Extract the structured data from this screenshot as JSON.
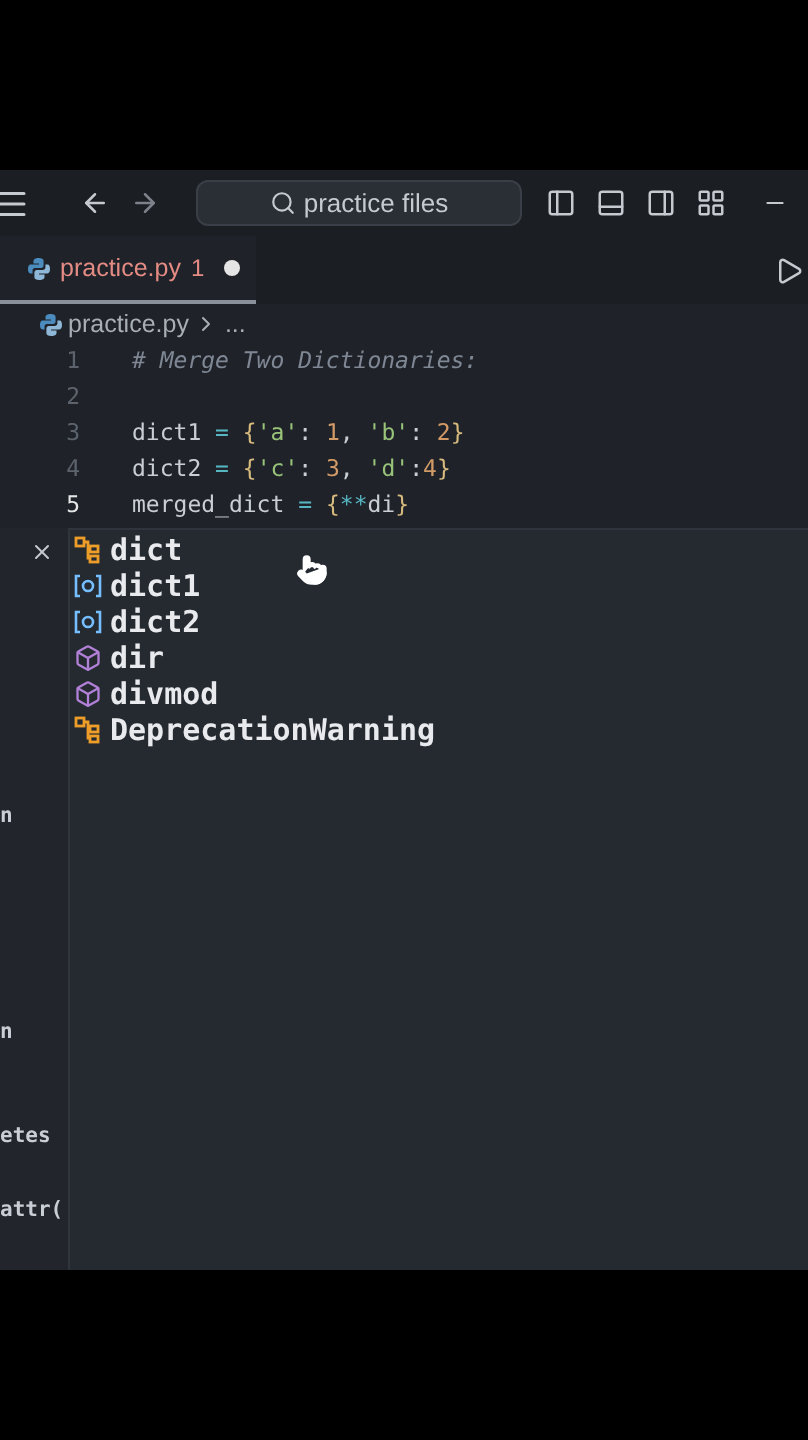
{
  "title_bar": {
    "search": "practice files"
  },
  "tab": {
    "label": "practice.py",
    "problems": "1",
    "modified": true,
    "selected": true
  },
  "breadcrumb": [
    "practice.py",
    "..."
  ],
  "code_lines": [
    {
      "number": "1",
      "current": false,
      "tokens": [
        {
          "text": "# Merge Two Dictionaries:",
          "kind": "comment"
        }
      ]
    },
    {
      "number": "2",
      "current": false
    },
    {
      "number": "3",
      "current": false,
      "tokens": [
        {
          "text": "dict1 ",
          "kind": "name"
        },
        {
          "text": "=",
          "kind": "op"
        },
        {
          "text": " {",
          "kind": "brace"
        },
        {
          "text": "'a'",
          "kind": "string"
        },
        {
          "text": ": ",
          "kind": "name"
        },
        {
          "text": "1",
          "kind": "number"
        },
        {
          "text": ", ",
          "kind": "name"
        },
        {
          "text": "'b'",
          "kind": "string"
        },
        {
          "text": ": ",
          "kind": "name"
        },
        {
          "text": "2",
          "kind": "number"
        },
        {
          "text": "}",
          "kind": "brace"
        }
      ]
    },
    {
      "number": "4",
      "current": false,
      "tokens": [
        {
          "text": "dict2 ",
          "kind": "name"
        },
        {
          "text": "=",
          "kind": "op"
        },
        {
          "text": " {",
          "kind": "brace"
        },
        {
          "text": "'c'",
          "kind": "string"
        },
        {
          "text": ": ",
          "kind": "name"
        },
        {
          "text": "3",
          "kind": "number"
        },
        {
          "text": ", ",
          "kind": "name"
        },
        {
          "text": "'d'",
          "kind": "string"
        },
        {
          "text": ":",
          "kind": "name"
        },
        {
          "text": "4",
          "kind": "number"
        },
        {
          "text": "}",
          "kind": "brace"
        }
      ]
    },
    {
      "number": "5",
      "current": true,
      "tokens": [
        {
          "text": "merged_dict ",
          "kind": "name"
        },
        {
          "text": "=",
          "kind": "op"
        },
        {
          "text": " {",
          "kind": "brace"
        },
        {
          "text": "**",
          "kind": "op"
        },
        {
          "text": "di",
          "kind": "name"
        },
        {
          "text": "}",
          "kind": "brace"
        }
      ]
    }
  ],
  "suggestions": [
    {
      "label": "dict",
      "kind": "class"
    },
    {
      "label": "dict1",
      "kind": "variable"
    },
    {
      "label": "dict2",
      "kind": "variable"
    },
    {
      "label": "dir",
      "kind": "function"
    },
    {
      "label": "divmod",
      "kind": "function"
    },
    {
      "label": "DeprecationWarning",
      "kind": "class"
    }
  ],
  "side_panel": {
    "fragments": [
      "n",
      "n",
      "etes",
      "attr("
    ]
  }
}
